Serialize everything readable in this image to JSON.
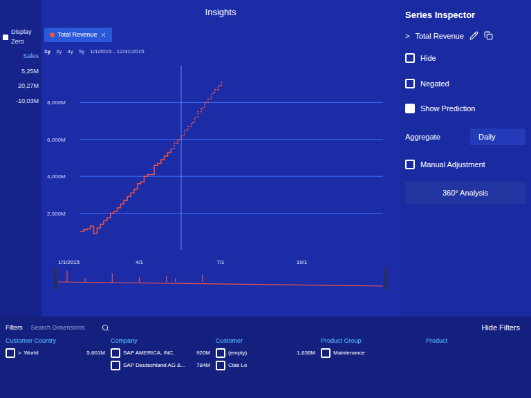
{
  "window": {
    "title": "Insights"
  },
  "left_panel": {
    "label": "Display Zero",
    "header": "Sales",
    "values": [
      "5,25M",
      "20,27M",
      "-10,03M"
    ]
  },
  "series_chip": {
    "label": "Total Revenue",
    "color": "#e8534a"
  },
  "ranges": [
    {
      "label": "1y",
      "selected": true
    },
    {
      "label": "2y",
      "selected": false
    },
    {
      "label": "4y",
      "selected": false
    },
    {
      "label": "5y",
      "selected": false
    }
  ],
  "date_range": "1/1/2015 - 12/31/2015",
  "chart": {
    "y_max": 10000,
    "x_max": 90,
    "y_ticks": [
      {
        "value": 2000,
        "label": "2,000M"
      },
      {
        "value": 4000,
        "label": "4,000M"
      },
      {
        "value": 6000,
        "label": "6,000M"
      },
      {
        "value": 8000,
        "label": "8,000M"
      }
    ],
    "cursor_index": 30,
    "series": [
      {
        "name": "Total Revenue",
        "color": "#e8534a",
        "values": [
          1000,
          1100,
          1150,
          1300,
          900,
          1200,
          1400,
          1600,
          1750,
          2000,
          2100,
          2300,
          2500,
          2700,
          2900,
          3100,
          3300,
          3600,
          3700,
          4000,
          4100,
          4100,
          4600,
          4700,
          4900,
          5100,
          5300,
          5500
        ],
        "prediction": [
          5500,
          5800,
          6000,
          6200,
          6500,
          6700,
          6900,
          7200,
          7500,
          7700,
          8000,
          8200,
          8500,
          8700,
          8900,
          9200
        ]
      }
    ]
  },
  "timeline": {
    "ticks": [
      "1/1/2015",
      "4/1",
      "7/1",
      "10/1"
    ],
    "overview": [
      0,
      0.9,
      0,
      0.3,
      0,
      0,
      0.7,
      0,
      0,
      0.4,
      0,
      0,
      0.5,
      0.3,
      0,
      0,
      0.6,
      0,
      0,
      0,
      0,
      0,
      0,
      0,
      0,
      0,
      0,
      0,
      0,
      0,
      0,
      0,
      0,
      0,
      0,
      0
    ]
  },
  "inspector": {
    "title": "Series Inspector",
    "series": "Total Revenue",
    "expander": ">",
    "options": [
      {
        "label": "Hide",
        "checked": false
      },
      {
        "label": "Negated",
        "checked": false
      },
      {
        "label": "Show Prediction",
        "checked": true
      }
    ],
    "aggregate": {
      "label": "Aggregate",
      "value": "Daily"
    },
    "manual": {
      "label": "Manual Adjustment",
      "checked": false
    },
    "button": "360° Analysis"
  },
  "filters": {
    "title": "Filters",
    "search_placeholder": "Search Dimensions",
    "hide_button": "Hide Filters",
    "columns": [
      {
        "header": "Customer Country",
        "items": [
          {
            "expander": ">",
            "label": "World",
            "value": "5,601M",
            "checked": false
          }
        ]
      },
      {
        "header": "Company",
        "items": [
          {
            "expander": "",
            "label": "SAP AMERICA, INC.",
            "value": "920M",
            "checked": false
          },
          {
            "expander": "",
            "label": "SAP Deutschland AG &...",
            "value": "784M",
            "checked": false
          }
        ]
      },
      {
        "header": "Customer",
        "items": [
          {
            "expander": "",
            "label": "(empty)",
            "value": "1,636M",
            "checked": false
          },
          {
            "expander": "",
            "label": "Clas Lo",
            "value": "",
            "checked": false
          }
        ]
      },
      {
        "header": "Product Group",
        "items": [
          {
            "expander": "",
            "label": "Maintenance",
            "value": "",
            "checked": false
          }
        ]
      },
      {
        "header": "Product",
        "items": []
      }
    ]
  }
}
